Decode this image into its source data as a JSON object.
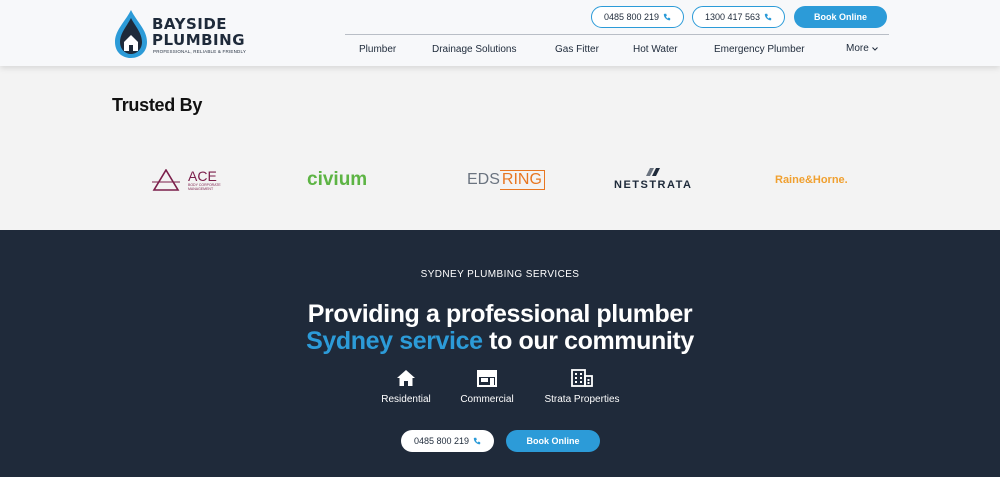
{
  "header": {
    "logo": {
      "name_line1": "BAYSIDE",
      "name_line2": "PLUMBING",
      "tagline": "PROFESSIONAL, RELIABLE & FRIENDLY"
    },
    "phone1": "0485 800 219",
    "phone2": "1300 417 563",
    "book": "Book Online",
    "nav": [
      "Plumber",
      "Drainage Solutions",
      "Gas Fitter",
      "Hot Water",
      "Emergency Plumber",
      "More"
    ]
  },
  "trusted": {
    "title": "Trusted By",
    "brands": {
      "ace": {
        "name": "ACE",
        "sub": "BODY CORPORATE MANAGEMENT"
      },
      "civium": "civium",
      "eds": {
        "a": "EDS",
        "b": "RING"
      },
      "netstrata": "NETSTRATA",
      "raine": "Raine&Horne."
    }
  },
  "services": {
    "eyebrow": "SYDNEY PLUMBING SERVICES",
    "headline_line1": "Providing a professional plumber",
    "headline_accent": "Sydney service",
    "headline_rest": " to our community",
    "items": [
      "Residential",
      "Commercial",
      "Strata Properties"
    ],
    "phone": "0485 800 219",
    "book": "Book Online"
  },
  "colors": {
    "accent": "#2c9bd8",
    "dark": "#1f2a3a",
    "civium": "#5db444",
    "eds": "#e87722",
    "ace": "#7b1e4a",
    "raine": "#f0a030"
  },
  "icons": [
    "logo-drop-icon",
    "phone-icon",
    "chevron-down-icon",
    "home-icon",
    "shop-icon",
    "building-icon"
  ]
}
